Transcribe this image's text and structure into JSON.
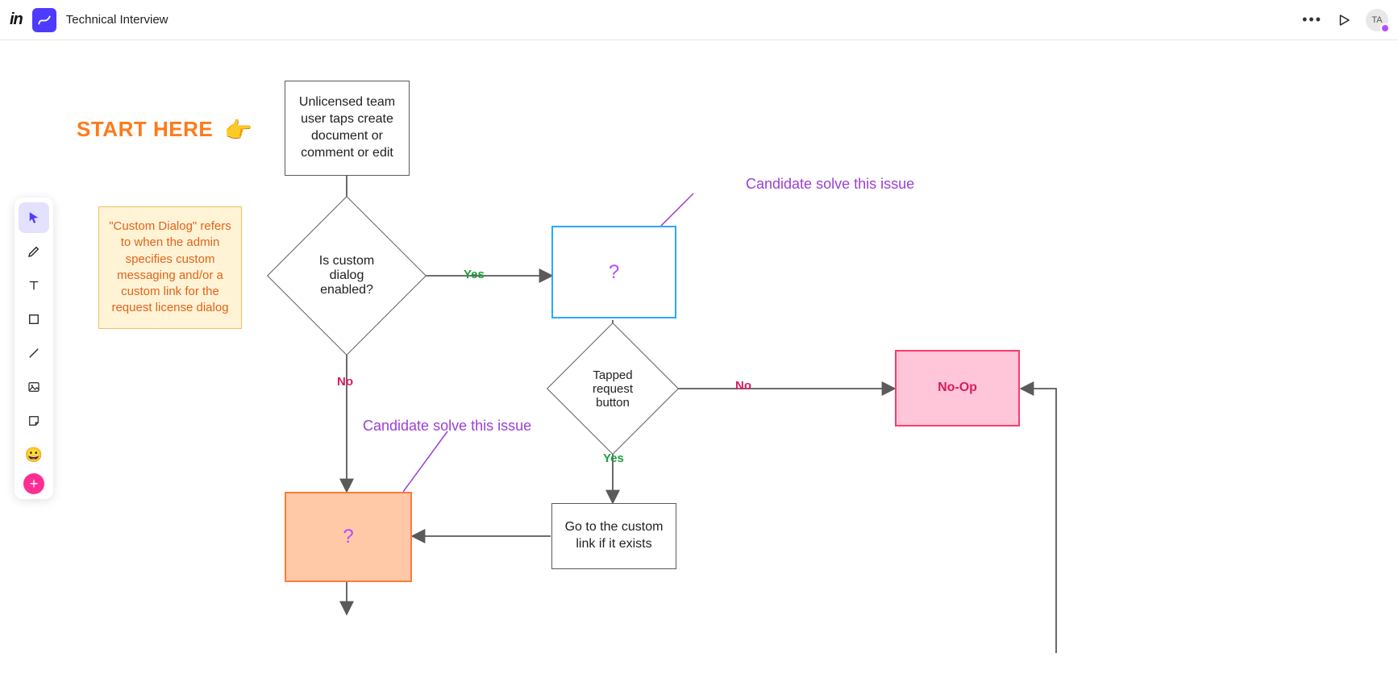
{
  "header": {
    "logo_text": "in",
    "doc_title": "Technical Interview",
    "avatar_initials": "TA"
  },
  "toolbar": {
    "items": [
      {
        "name": "pointer",
        "selected": true
      },
      {
        "name": "pencil"
      },
      {
        "name": "text"
      },
      {
        "name": "shape"
      },
      {
        "name": "line"
      },
      {
        "name": "image"
      },
      {
        "name": "sticky"
      },
      {
        "name": "emoji",
        "glyph": "😀"
      },
      {
        "name": "add",
        "glyph": "+"
      }
    ]
  },
  "canvas": {
    "start_label": "START HERE",
    "note_custom_dialog": "\"Custom Dialog\" refers to when the admin specifies custom messaging and/or a custom link for the request license dialog",
    "box_start": "Unlicensed team user taps create document or comment or edit",
    "diamond_custom": "Is custom dialog enabled?",
    "box_blue_q": "?",
    "diamond_tapped": "Tapped request button",
    "box_orange_q": "?",
    "box_goto": "Go to the custom link if it exists",
    "box_noop": "No-Op",
    "annotation1": "Candidate solve this issue",
    "annotation2": "Candidate solve this issue",
    "labels": {
      "yes": "Yes",
      "no": "No"
    }
  }
}
